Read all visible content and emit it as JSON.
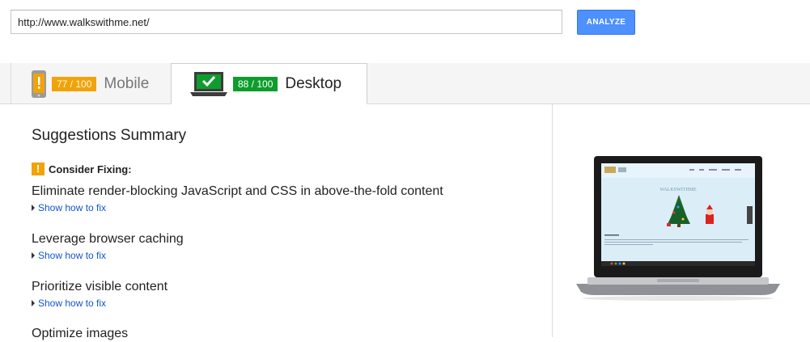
{
  "search": {
    "url_value": "http://www.walkswithme.net/"
  },
  "analyze_label": "ANALYZE",
  "tabs": [
    {
      "score": "77 / 100",
      "label": "Mobile",
      "status_color": "#f0a30a"
    },
    {
      "score": "88 / 100",
      "label": "Desktop",
      "status_color": "#0e9d2d"
    }
  ],
  "summary": {
    "title": "Suggestions Summary",
    "consider_label": "Consider Fixing:",
    "warning_icon_glyph": "!",
    "link_label": "Show how to fix",
    "suggestions": [
      {
        "title": "Eliminate render-blocking JavaScript and CSS in above-the-fold content"
      },
      {
        "title": "Leverage browser caching"
      },
      {
        "title": "Prioritize visible content"
      },
      {
        "title": "Optimize images"
      }
    ]
  },
  "preview": {
    "site_name": "WALKSWITHME"
  },
  "colors": {
    "accent": "#4d90fe",
    "link": "#1155cc",
    "warning": "#f0a30a",
    "good": "#0e9d2d"
  }
}
